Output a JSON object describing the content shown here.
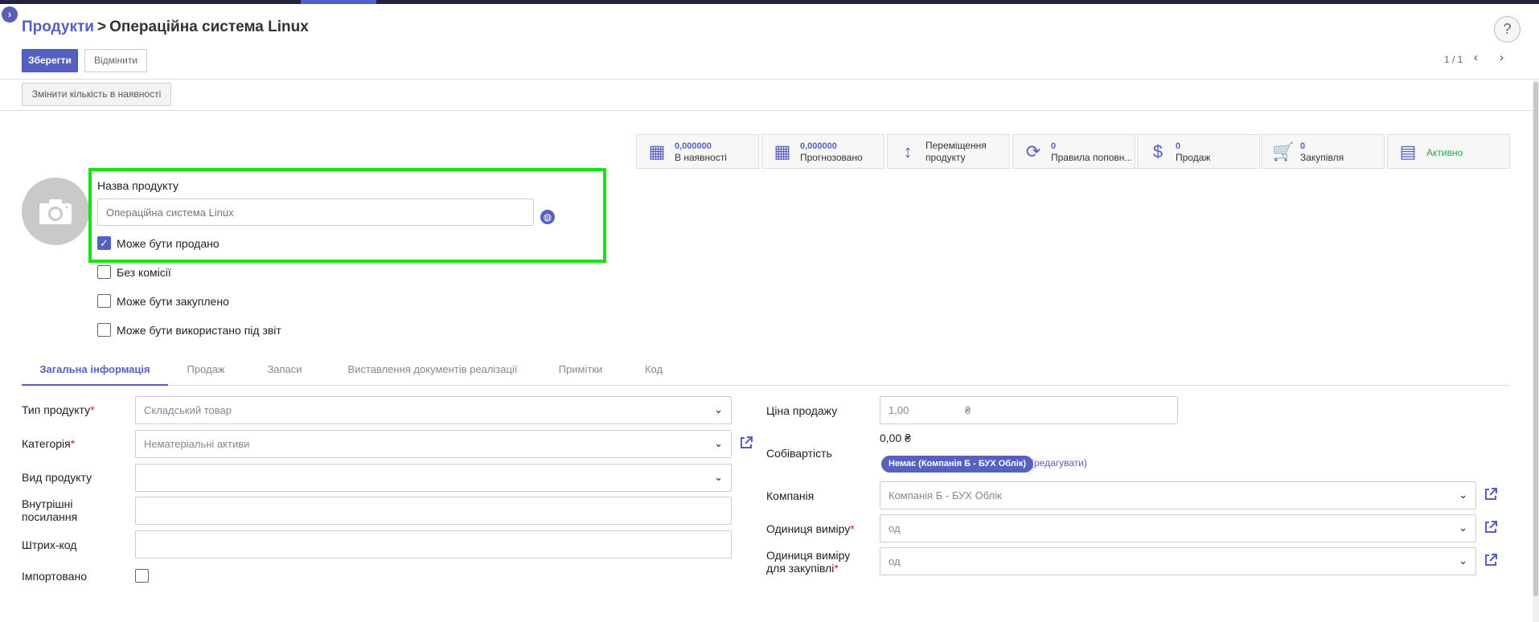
{
  "breadcrumb": {
    "parent": "Продукти",
    "separator": ">",
    "current": "Операційна система Linux"
  },
  "toolbar": {
    "save_label": "Зберегти",
    "discard_label": "Відмінити",
    "pager": "1 / 1",
    "help": "?"
  },
  "actions": {
    "update_qty_label": "Змінити кількість в наявності"
  },
  "smart_buttons": [
    {
      "value": "0,000000",
      "label": "В наявності",
      "icon": "building-icon"
    },
    {
      "value": "0,000000",
      "label": "Прогнозовано",
      "icon": "building-icon"
    },
    {
      "label": "Переміщення продукту",
      "label_line1": "Переміщення",
      "label_line2": "продукту",
      "icon": "arrows-vertical-icon"
    },
    {
      "value": "0",
      "label": "Правила поповн...",
      "icon": "refresh-icon"
    },
    {
      "value": "0",
      "label": "Продаж",
      "icon": "dollar-icon"
    },
    {
      "value": "0",
      "label": "Закупівля",
      "icon": "cart-icon"
    },
    {
      "label": "Активно",
      "icon": "archive-icon"
    }
  ],
  "product": {
    "name_label": "Назва продукту",
    "name_placeholder": "Операційна система Linux",
    "checkboxes": [
      {
        "label": "Може бути продано",
        "checked": true
      },
      {
        "label": "Без комісії",
        "checked": false
      },
      {
        "label": "Може бути закуплено",
        "checked": false
      },
      {
        "label": "Може бути використано під звіт",
        "checked": false
      }
    ]
  },
  "tabs": [
    "Загальна інформація",
    "Продаж",
    "Запаси",
    "Виставлення документів реалізації",
    "Примітки",
    "Код"
  ],
  "general": {
    "product_type_label": "Тип продукту",
    "product_type_value": "Складський товар",
    "category_label": "Категорія",
    "category_value": "Нематеріальні активи",
    "kind_label": "Вид продукту",
    "internal_ref_label_1": "Внутрішні",
    "internal_ref_label_2": "посилання",
    "barcode_label": "Штрих-код",
    "imported_label": "Імпортовано",
    "sale_price_label": "Ціна продажу",
    "sale_price_value": "1,00",
    "currency": "₴",
    "cost_label": "Собівартість",
    "cost_value": "0,00 ₴",
    "tax_badge": "Немає (Компанія Б - БУХ Облік)",
    "edit_link": "(редагувати)",
    "company_label": "Компанія",
    "company_value": "Компанія Б - БУХ Облік",
    "uom_label": "Одиниця виміру",
    "uom_value": "од",
    "purchase_uom_label_1": "Одиниця виміру",
    "purchase_uom_label_2": "для закупівлі",
    "purchase_uom_value": "од"
  },
  "colors": {
    "accent": "#5660c0",
    "highlight": "#17e312",
    "required": "#e02020"
  }
}
